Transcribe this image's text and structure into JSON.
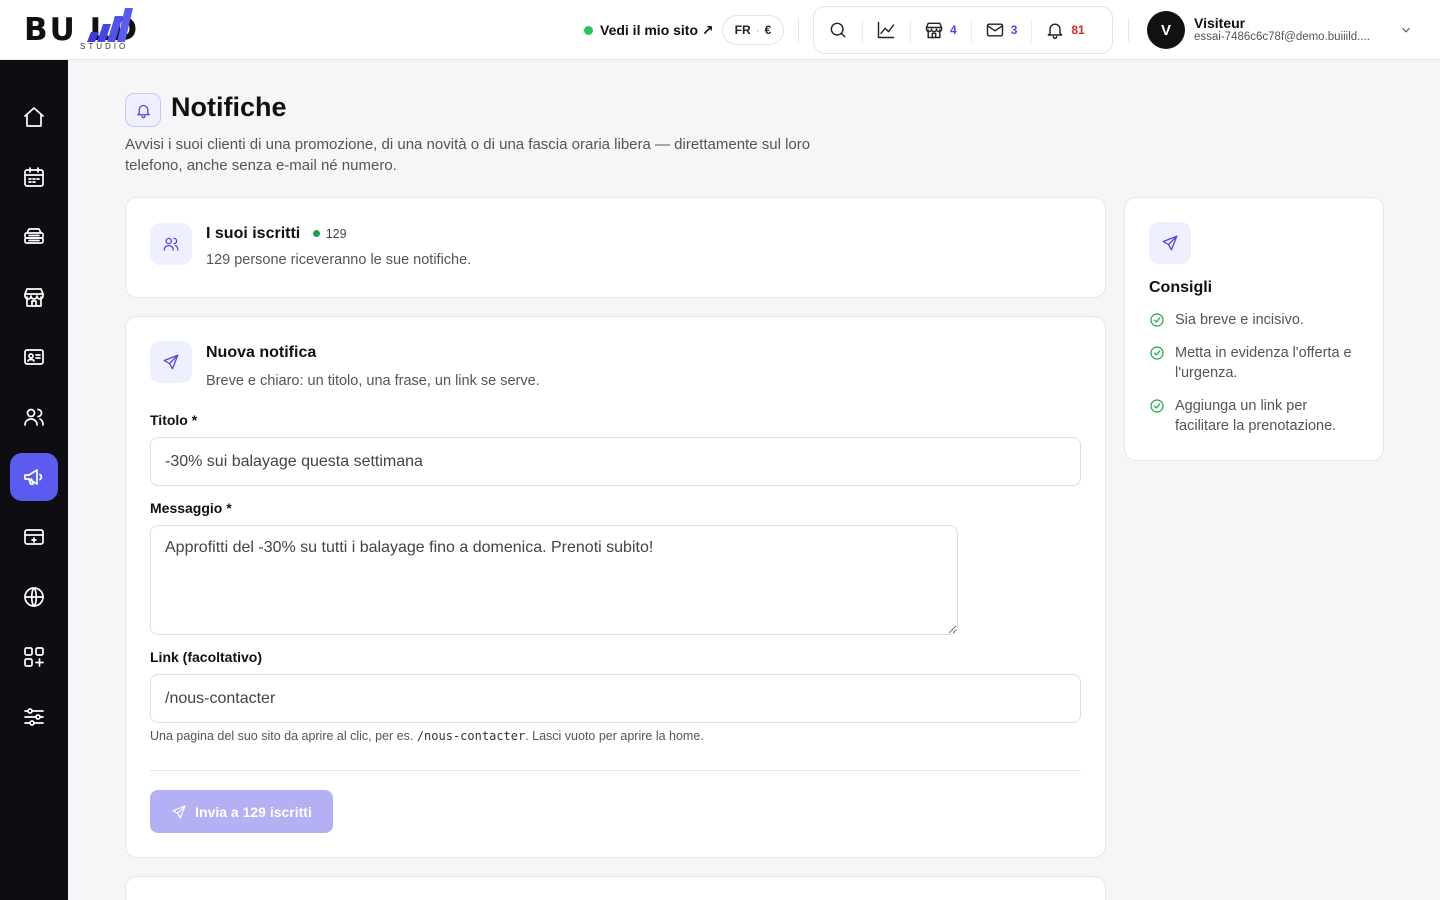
{
  "brand": {
    "logo_main": "BU  LD",
    "logo_sub": "STUDIO",
    "accent": "#5b5bf0"
  },
  "topbar": {
    "site_link": "Vedi il mio sito ↗",
    "lang": "FR",
    "currency": "€",
    "shop_count": "4",
    "mail_count": "3",
    "notif_count": "81",
    "user": {
      "initial": "V",
      "name": "Visiteur",
      "email": "essai-7486c6c78f@demo.buiiild...."
    }
  },
  "sidebar": {
    "items": [
      {
        "name": "home",
        "icon": "home-icon"
      },
      {
        "name": "calendar",
        "icon": "calendar-icon"
      },
      {
        "name": "services",
        "icon": "stack-icon"
      },
      {
        "name": "shop",
        "icon": "store-icon"
      },
      {
        "name": "contacts",
        "icon": "id-card-icon"
      },
      {
        "name": "clients",
        "icon": "users-icon"
      },
      {
        "name": "notifications",
        "icon": "megaphone-icon",
        "active": true
      },
      {
        "name": "payments",
        "icon": "card-icon"
      },
      {
        "name": "website",
        "icon": "globe-icon"
      },
      {
        "name": "apps",
        "icon": "grid-plus-icon"
      },
      {
        "name": "settings",
        "icon": "sliders-icon"
      }
    ]
  },
  "page": {
    "title": "Notifiche",
    "description": "Avvisi i suoi clienti di una promozione, di una novità o di una fascia oraria libera — direttamente sul loro telefono, anche senza e-mail né numero."
  },
  "subscribers": {
    "title": "I suoi iscritti",
    "count": "129",
    "subtitle": "129 persone riceveranno le sue notifiche."
  },
  "form": {
    "title": "Nuova notifica",
    "subtitle": "Breve e chiaro: un titolo, una frase, un link se serve.",
    "title_label": "Titolo *",
    "title_value": "-30% sui balayage questa settimana",
    "message_label": "Messaggio *",
    "message_value": "Approfitti del -30% su tutti i balayage fino a domenica. Prenoti subito!",
    "link_label": "Link (facoltativo)",
    "link_value": "/nous-contacter",
    "hint_before": "Una pagina del suo sito da aprire al clic, per es. ",
    "hint_code": "/nous-contacter",
    "hint_after": ". Lasci vuoto per aprire la home.",
    "send_label": "Invia a 129 iscritti"
  },
  "tips": {
    "title": "Consigli",
    "items": [
      "Sia breve e incisivo.",
      "Metta in evidenza l'offerta e l'urgenza.",
      "Aggiunga un link per facilitare la prenotazione."
    ]
  }
}
